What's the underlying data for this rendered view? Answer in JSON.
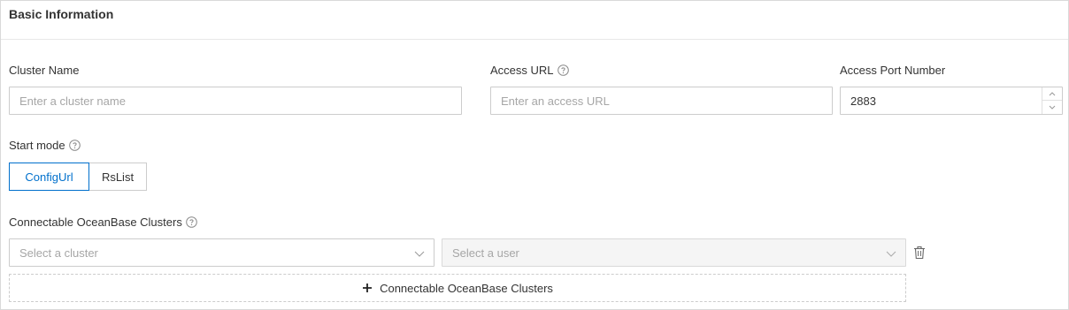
{
  "section": {
    "title": "Basic Information"
  },
  "cluster_name": {
    "label": "Cluster Name",
    "placeholder": "Enter a cluster name"
  },
  "access_url": {
    "label": "Access URL",
    "placeholder": "Enter an access URL"
  },
  "access_port": {
    "label": "Access Port Number",
    "value": "2883"
  },
  "start_mode": {
    "label": "Start mode",
    "options": [
      "ConfigUrl",
      "RsList"
    ],
    "selected": "ConfigUrl"
  },
  "connectable_clusters": {
    "label": "Connectable OceanBase Clusters",
    "cluster_placeholder": "Select a cluster",
    "user_placeholder": "Select a user",
    "add_button_label": "Connectable OceanBase Clusters"
  },
  "colors": {
    "accent": "#0070cc",
    "border": "#cccccc",
    "placeholder": "#a6a6a6",
    "disabled_bg": "#f5f5f5"
  },
  "icons": [
    "help-icon",
    "chevron-down-icon",
    "chevron-up-icon",
    "trash-icon",
    "plus-icon"
  ]
}
